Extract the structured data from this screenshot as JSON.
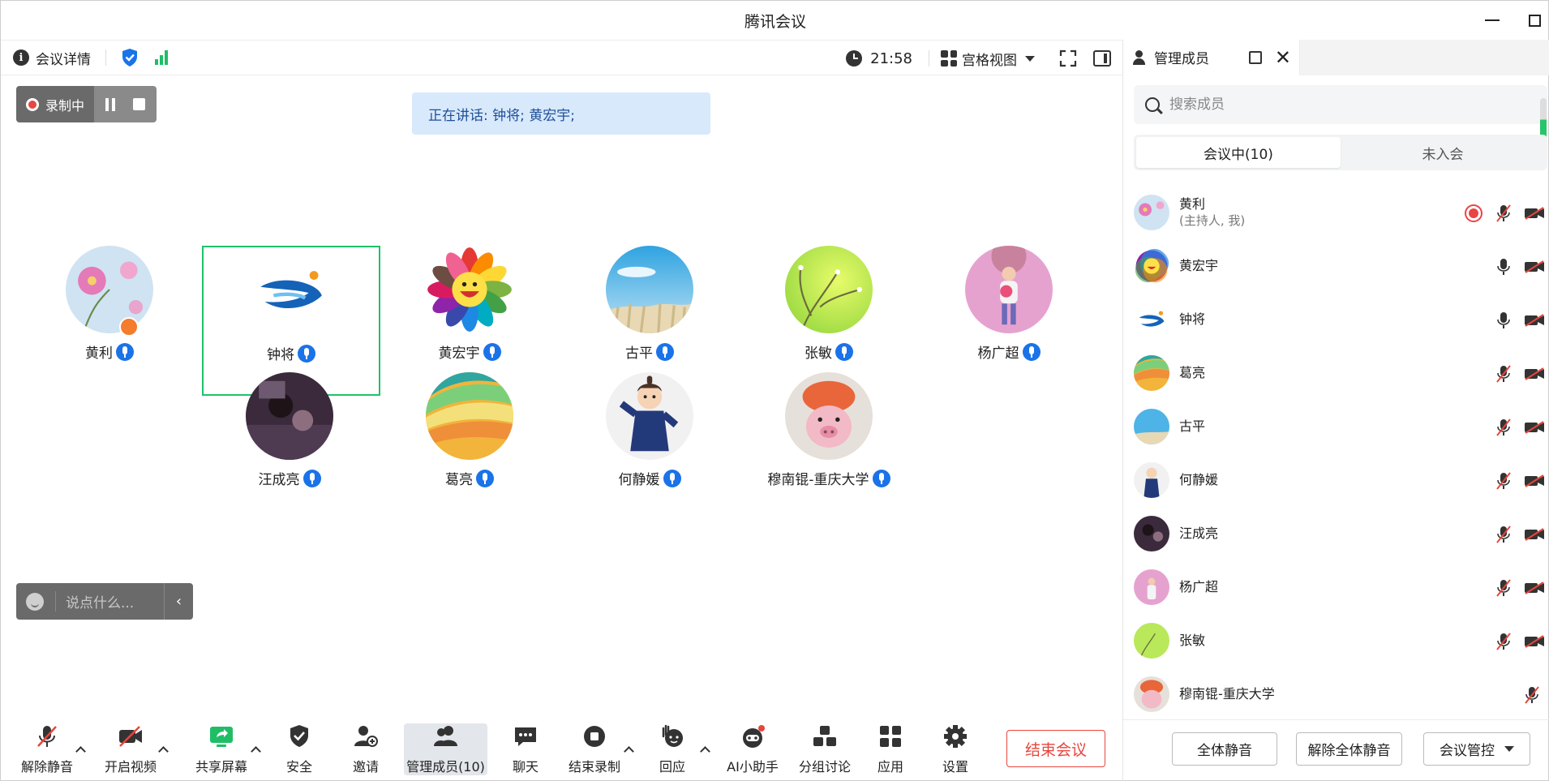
{
  "window": {
    "title": "腾讯会议"
  },
  "topbar": {
    "details_label": "会议详情",
    "time": "21:58",
    "view_label": "宫格视图"
  },
  "recording": {
    "label": "录制中"
  },
  "speaking": {
    "text": "正在讲话: 钟将; 黄宏宇;"
  },
  "participants": [
    {
      "name": "黄利",
      "avatar": "flower-photo"
    },
    {
      "name": "钟将",
      "avatar": "logo-swirl"
    },
    {
      "name": "黄宏宇",
      "avatar": "smiley-flower"
    },
    {
      "name": "古平",
      "avatar": "sky-reeds"
    },
    {
      "name": "张敏",
      "avatar": "green-branch"
    },
    {
      "name": "杨广超",
      "avatar": "child-pink"
    },
    {
      "name": "汪成亮",
      "avatar": "dark-photo"
    },
    {
      "name": "葛亮",
      "avatar": "rainbow-waves"
    },
    {
      "name": "何静媛",
      "avatar": "cartoon-boy"
    },
    {
      "name": "穆南锟-重庆大学",
      "avatar": "pink-pig"
    }
  ],
  "chat": {
    "placeholder": "说点什么..."
  },
  "toolbar": {
    "unmute": "解除静音",
    "video": "开启视频",
    "share": "共享屏幕",
    "security": "安全",
    "invite": "邀请",
    "members": "管理成员(10)",
    "chat": "聊天",
    "stop_record": "结束录制",
    "react": "回应",
    "ai": "AI小助手",
    "breakout": "分组讨论",
    "apps": "应用",
    "settings": "设置",
    "end": "结束会议"
  },
  "panel": {
    "title": "管理成员",
    "search_placeholder": "搜索成员",
    "tab_in": "会议中(10)",
    "tab_out": "未入会",
    "members": [
      {
        "name": "黄利",
        "sub": "(主持人, 我)",
        "avatar": "flower-photo",
        "mic": "muted",
        "cam": "off",
        "recording": true
      },
      {
        "name": "黄宏宇",
        "sub": "",
        "avatar": "smiley-flower",
        "mic": "on",
        "cam": "off",
        "recording": false
      },
      {
        "name": "钟将",
        "sub": "",
        "avatar": "logo-swirl",
        "mic": "on",
        "cam": "off",
        "recording": false
      },
      {
        "name": "葛亮",
        "sub": "",
        "avatar": "rainbow-waves",
        "mic": "muted",
        "cam": "off",
        "recording": false
      },
      {
        "name": "古平",
        "sub": "",
        "avatar": "sky-reeds",
        "mic": "muted",
        "cam": "off",
        "recording": false
      },
      {
        "name": "何静媛",
        "sub": "",
        "avatar": "cartoon-boy",
        "mic": "muted",
        "cam": "off",
        "recording": false
      },
      {
        "name": "汪成亮",
        "sub": "",
        "avatar": "dark-photo",
        "mic": "muted",
        "cam": "off",
        "recording": false
      },
      {
        "name": "杨广超",
        "sub": "",
        "avatar": "child-pink",
        "mic": "muted",
        "cam": "off",
        "recording": false
      },
      {
        "name": "张敏",
        "sub": "",
        "avatar": "green-branch",
        "mic": "muted",
        "cam": "off",
        "recording": false
      },
      {
        "name": "穆南锟-重庆大学",
        "sub": "",
        "avatar": "pink-pig",
        "mic": "muted",
        "cam": "none",
        "recording": false
      }
    ],
    "mute_all": "全体静音",
    "unmute_all": "解除全体静音",
    "controls": "会议管控"
  },
  "colors": {
    "accent_green": "#1ec26a",
    "end_red": "#e8453c",
    "mic_blue": "#1a73e8"
  }
}
